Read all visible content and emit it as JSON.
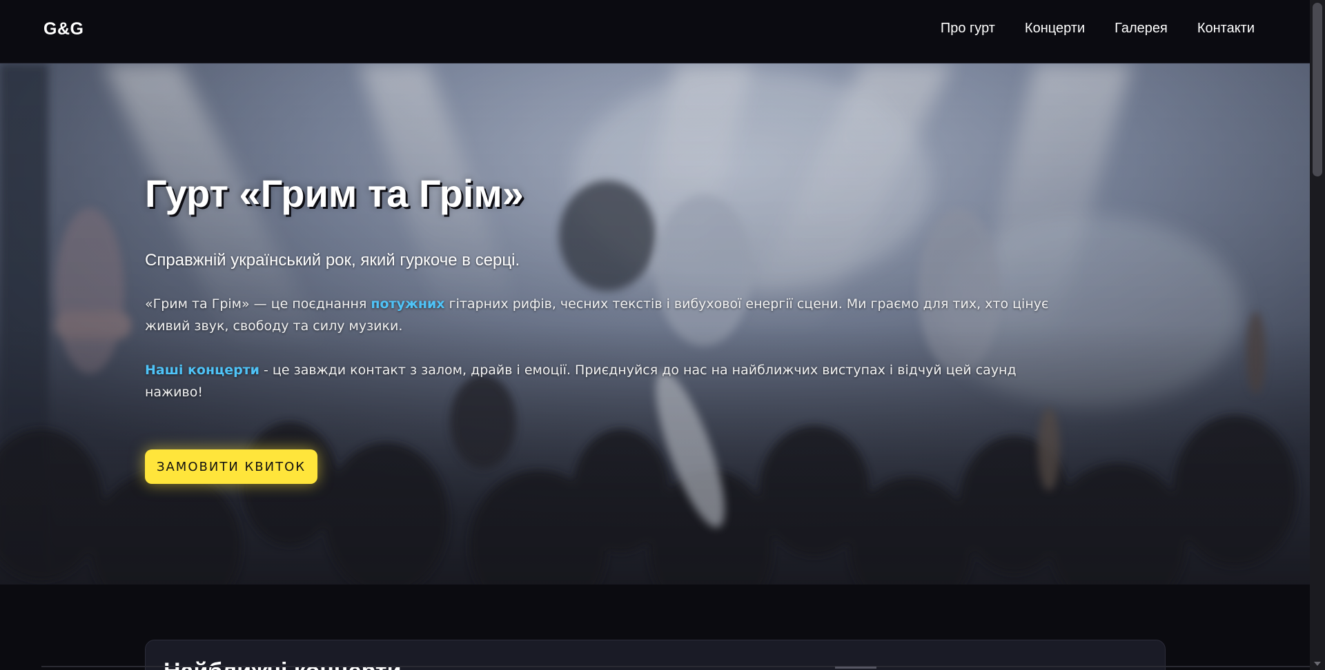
{
  "header": {
    "logo": "G&G",
    "nav": [
      {
        "label": "Про гурт"
      },
      {
        "label": "Концерти"
      },
      {
        "label": "Галерея"
      },
      {
        "label": "Контакти"
      }
    ]
  },
  "hero": {
    "title": "Гурт «Грим та Грім»",
    "subtitle": "Справжній український рок, який гуркоче в серці.",
    "p1_before": "«Грим та Грім» — це поєднання ",
    "p1_highlight": "потужних",
    "p1_after": " гітарних рифів, чесних текстів і вибухової енергії сцени. Ми граємо для тих, хто цінує живий звук, свободу та силу музики.",
    "p2_highlight": "Наші концерти",
    "p2_after": " - це завжди контакт з залом, драйв і емоції. Приєднуйся до нас на найближчих виступах і відчуй цей саунд наживо!",
    "cta_label": "ЗАМОВИТИ КВИТОК",
    "accent_color": "#4fc3f7",
    "cta_color": "#ffe53b"
  },
  "concerts": {
    "title": "Найближчі концерти"
  }
}
